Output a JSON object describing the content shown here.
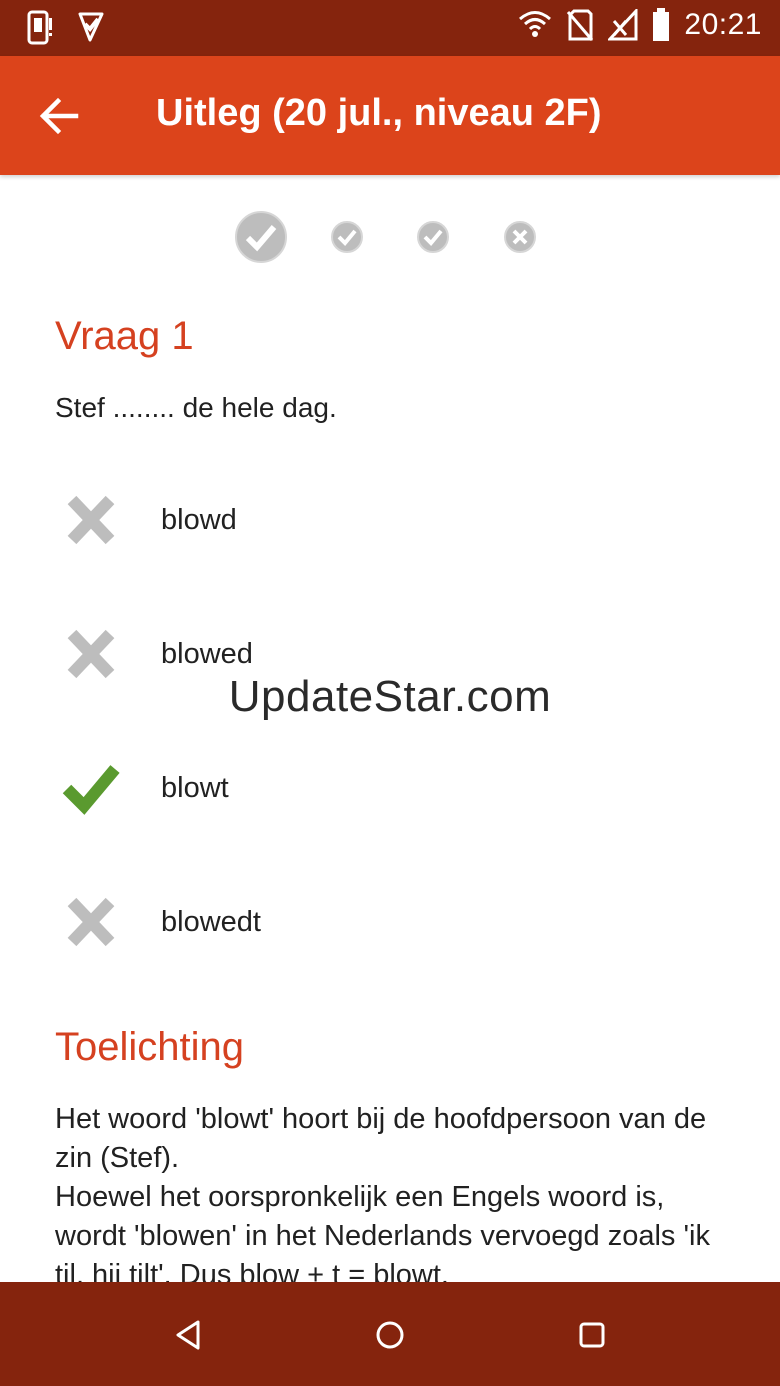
{
  "status_bar": {
    "time": "20:21",
    "left_icons": [
      "phone-alert-icon",
      "check-notification-icon"
    ],
    "right_icons": [
      "wifi-icon",
      "no-sim-icon",
      "no-signal-icon",
      "battery-icon"
    ]
  },
  "app_bar": {
    "title": "Uitleg (20 jul., niveau 2F)",
    "back_icon": "arrow-left-icon"
  },
  "progress": [
    {
      "state": "correct",
      "current": true
    },
    {
      "state": "correct",
      "current": false
    },
    {
      "state": "correct",
      "current": false
    },
    {
      "state": "wrong",
      "current": false
    }
  ],
  "question": {
    "heading": "Vraag 1",
    "text": "Stef ........ de hele dag."
  },
  "answers": [
    {
      "label": "blowd",
      "status": "wrong"
    },
    {
      "label": "blowed",
      "status": "wrong"
    },
    {
      "label": "blowt",
      "status": "correct"
    },
    {
      "label": "blowedt",
      "status": "wrong"
    }
  ],
  "explanation": {
    "heading": "Toelichting",
    "lines": [
      "Het woord 'blowt' hoort bij de hoofdpersoon van de zin (Stef).",
      "Hoewel het oorspronkelijk een Engels woord is, wordt 'blowen' in het Nederlands vervoegd zoals 'ik til, hij tilt'. Dus blow + t = blowt."
    ]
  },
  "watermark": "UpdateStar.com",
  "nav_bar": {
    "icons": [
      "back-triangle-icon",
      "home-circle-icon",
      "recents-square-icon"
    ]
  },
  "colors": {
    "status_bar": "#85240d",
    "app_bar": "#dc441b",
    "heading": "#d54120",
    "correct": "#5a9a2f",
    "wrong_grey": "#bdbdbd",
    "nav_bar": "#85240d"
  }
}
